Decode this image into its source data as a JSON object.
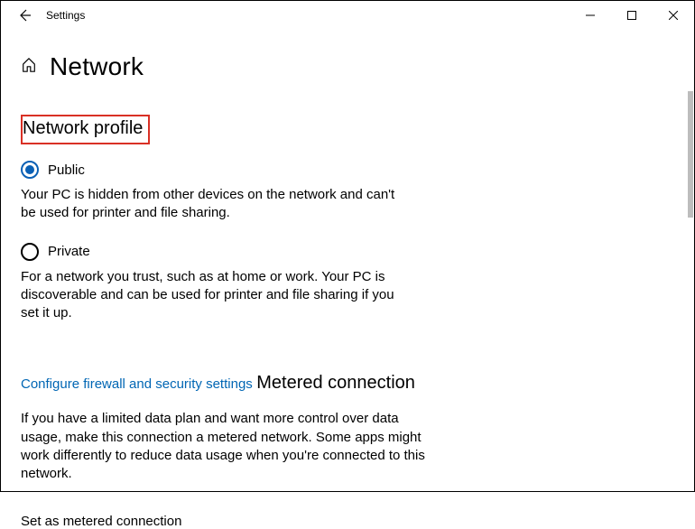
{
  "titlebar": {
    "label": "Settings"
  },
  "page": {
    "title": "Network"
  },
  "network_profile": {
    "heading": "Network profile",
    "options": [
      {
        "label": "Public",
        "selected": true,
        "desc": "Your PC is hidden from other devices on the network and can't be used for printer and file sharing."
      },
      {
        "label": "Private",
        "selected": false,
        "desc": "For a network you trust, such as at home or work. Your PC is discoverable and can be used for printer and file sharing if you set it up."
      }
    ],
    "link": "Configure firewall and security settings"
  },
  "metered": {
    "heading": "Metered connection",
    "desc": "If you have a limited data plan and want more control over data usage, make this connection a metered network. Some apps might work differently to reduce data usage when you're connected to this network.",
    "toggle_label": "Set as metered connection"
  }
}
